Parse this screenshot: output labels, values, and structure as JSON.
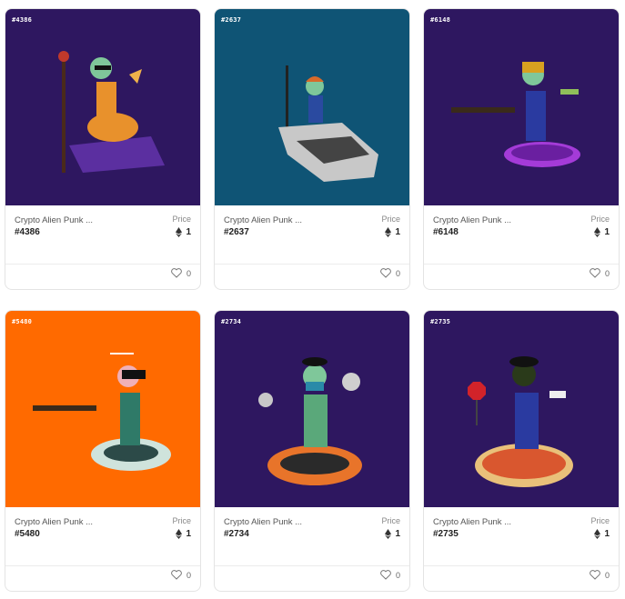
{
  "collection_name": "Crypto Alien Punk ...",
  "price_label": "Price",
  "colors": {
    "purple_bg": "#2e1760",
    "teal_bg": "#0f5475",
    "orange_bg": "#ff6a00"
  },
  "cards": [
    {
      "tag": "#4386",
      "name": "Crypto Alien Punk ...",
      "token": "#4386",
      "price_label": "Price",
      "price": "1",
      "likes": "0",
      "bg": "#2e1760"
    },
    {
      "tag": "#2637",
      "name": "Crypto Alien Punk ...",
      "token": "#2637",
      "price_label": "Price",
      "price": "1",
      "likes": "0",
      "bg": "#0f5475"
    },
    {
      "tag": "#6148",
      "name": "Crypto Alien Punk ...",
      "token": "#6148",
      "price_label": "Price",
      "price": "1",
      "likes": "0",
      "bg": "#2e1760"
    },
    {
      "tag": "#5480",
      "name": "Crypto Alien Punk ...",
      "token": "#5480",
      "price_label": "Price",
      "price": "1",
      "likes": "0",
      "bg": "#ff6a00"
    },
    {
      "tag": "#2734",
      "name": "Crypto Alien Punk ...",
      "token": "#2734",
      "price_label": "Price",
      "price": "1",
      "likes": "0",
      "bg": "#2e1760"
    },
    {
      "tag": "#2735",
      "name": "Crypto Alien Punk ...",
      "token": "#2735",
      "price_label": "Price",
      "price": "1",
      "likes": "0",
      "bg": "#2e1760"
    }
  ],
  "icons": {
    "currency": "ethereum-icon",
    "like": "heart-icon"
  }
}
